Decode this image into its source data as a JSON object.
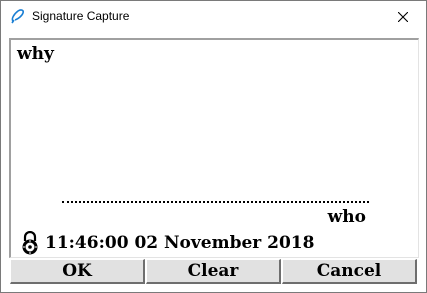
{
  "window": {
    "title": "Signature Capture"
  },
  "titlebar": {
    "app_icon": "pen-icon",
    "close_icon": "close-icon"
  },
  "panel": {
    "reason": "why",
    "signer": "who",
    "lock_icon": "lock-icon",
    "timestamp": "11:46:00 02 November 2018"
  },
  "buttons": {
    "ok": "OK",
    "clear": "Clear",
    "cancel": "Cancel"
  }
}
